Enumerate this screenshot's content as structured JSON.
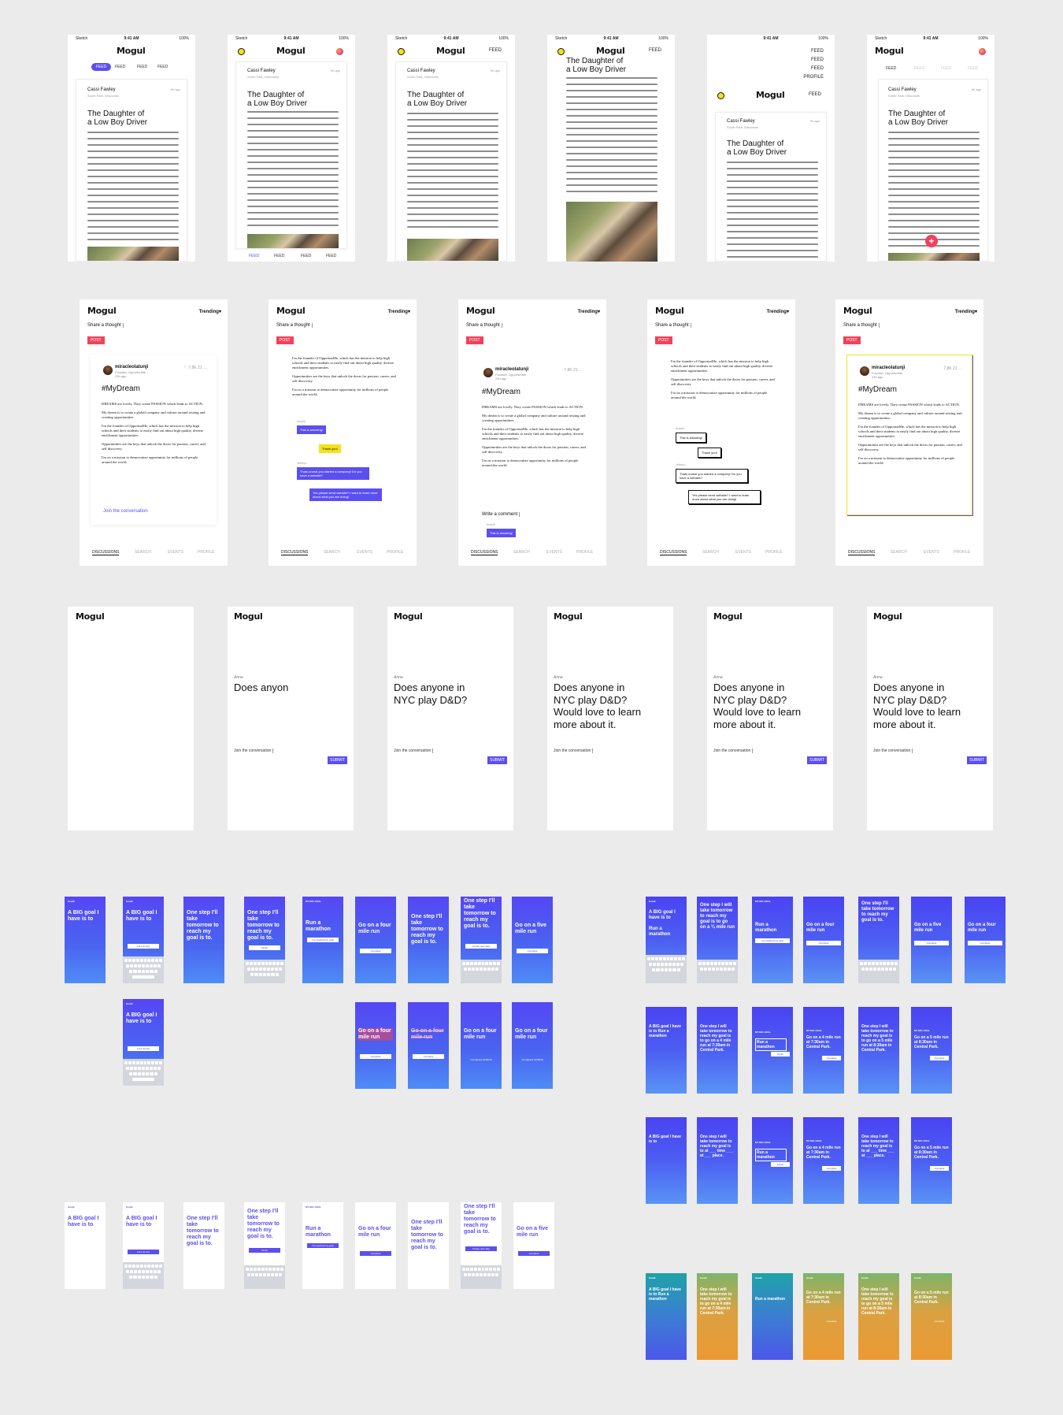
{
  "colors": {
    "background": "#ebebeb",
    "accent_purple": "#5b4ff0",
    "accent_red": "#f2415a",
    "accent_yellow": "#f5e11a",
    "goal_blue_top": "#5547f5",
    "goal_blue_bottom": "#4f8cf7"
  },
  "status_bar": {
    "carrier": "Sketch",
    "time": "9:41 AM",
    "battery": "100%"
  },
  "app": {
    "logo": "Mogul"
  },
  "story": {
    "author": "Cassi Fawley",
    "location": "South Park, Wisconsin",
    "age": "9h ago",
    "title_line1": "The Daughter of",
    "title_line2": "a Low Boy Driver",
    "feed_label": "FEED",
    "profile_label": "PROFILE",
    "fab_icon": "+"
  },
  "discussion": {
    "share": "Share a thought",
    "trending": "Trending",
    "post": "POST",
    "user": "miracleolatunji",
    "user_sub": "Founder, OpportunMe",
    "user_time": "23h ago",
    "likes": "7.8K",
    "comments": "21",
    "hashtag": "#MyDream",
    "p1": "DREAMS are lovely. They create PASSION which leads to ACTION.",
    "p2": "My dream is to create a global company and culture around seizing and creating opportunities.",
    "p3": "I'm the founder of OpportunMe, which has the mission to help high schools and their students to easily find out about high quality, diverse enrichment opportunities.",
    "p4": "Opportunities are the keys that unlock the doors for passion, career, and self discovery.",
    "p5": "I'm on a mission to democratize opportunity for millions of people around the world.",
    "join": "Join the conversation",
    "write_comment": "Write a comment",
    "nav": [
      "DISCUSSIONS",
      "SEARCH",
      "EVENTS",
      "PROFILE"
    ],
    "chat": {
      "name1": "Ananth",
      "msg1": "This is amazing!",
      "msg2": "Thank you!",
      "name2": "Jeffrey L",
      "msg3": "Thats unreal you started a company! Do you have a website?",
      "msg4": "Yes please send website? I want to learn more about what you are doing!"
    }
  },
  "conversation": {
    "name": "Anna",
    "q1": "Does anyon",
    "q2_line1": "Does anyone in",
    "q2_line2": "NYC play D&D?",
    "q3_line3": "Would love to learn",
    "q3_line4": "more about it.",
    "join": "Join the conversation",
    "submit": "SUBMIT"
  },
  "goals": {
    "logo": "Goald",
    "big_goal": "A BIG goal I have is to",
    "one_step": "One step I'll take tomorrow to reach my goal is to.",
    "run_marathon": "Run a marathon",
    "four_mile": "Go on a four mile run",
    "five_mile": "Go on a five mile run",
    "lets_do_this": "Let's do this",
    "finish": "Finish",
    "im_reached": "I've reached my goal",
    "complete": "Complete",
    "completed": "Completed 10/05/18",
    "create": "Create next step",
    "my_big_goal": "MY BIG GOAL",
    "long_step1": "One step I will take tomorrow to reach my goal is to go on a ¼ mile run",
    "long_step2": "One step I will take tomorrow to reach my goal is to go on a 4 mile run at 7:30am in Central Park.",
    "long_step3": "Go on a 4 mile run at 7:30am in Central Park.",
    "long_step4": "One step I will take tomorrow to reach my goal is to go on a 5 mile run at 8:30am in Central Park.",
    "long_step5": "Go on a 5 mile run at 8:30am in Central Park.",
    "fill_step": "One step I will take tomorrow to reach my goal is to",
    "fill_blank": "at ___ time ___ at ___ place."
  }
}
